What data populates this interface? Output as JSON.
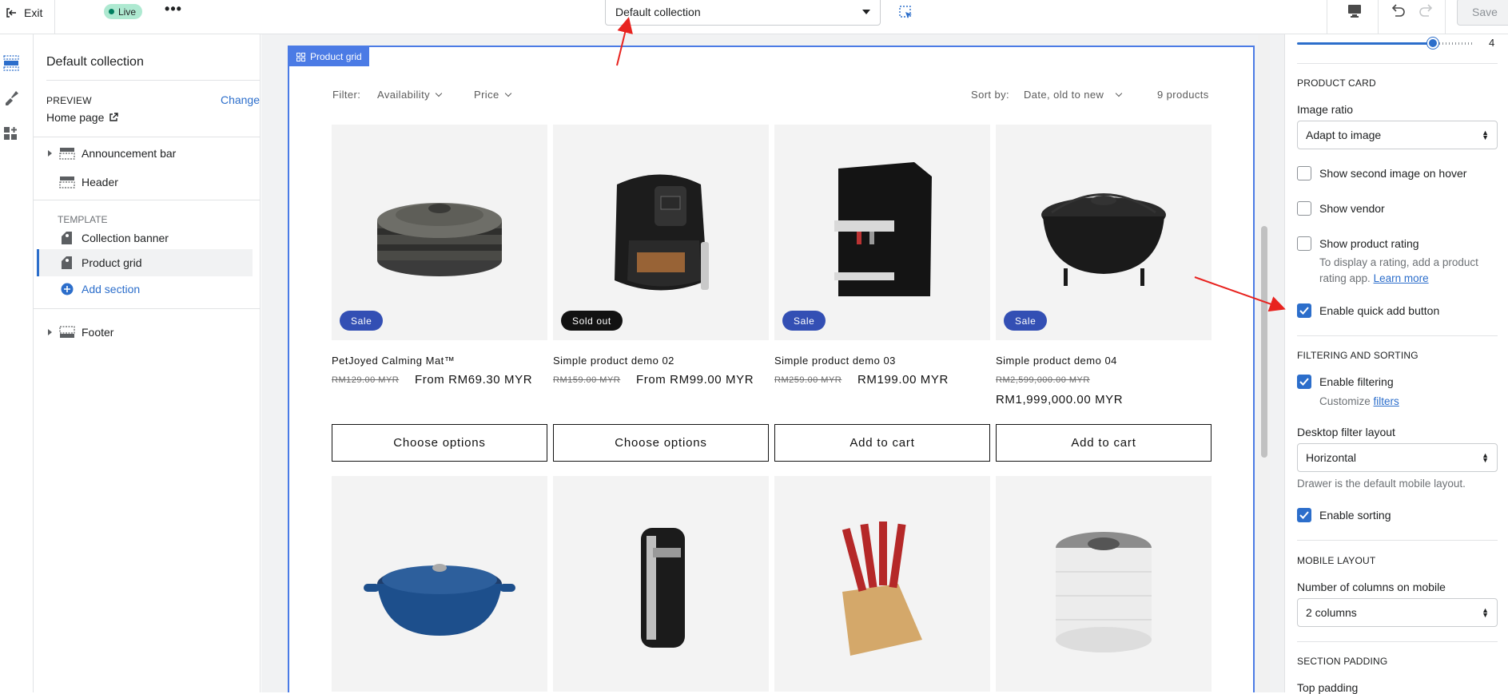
{
  "topbar": {
    "exit_label": "Exit",
    "live_label": "Live",
    "template_select_value": "Default collection",
    "save_label": "Save"
  },
  "sidebar": {
    "title": "Default collection",
    "preview_label": "PREVIEW",
    "change_label": "Change",
    "preview_page": "Home page",
    "items": [
      {
        "label": "Announcement bar"
      },
      {
        "label": "Header"
      }
    ],
    "template_label": "TEMPLATE",
    "template_items": [
      {
        "label": "Collection banner"
      },
      {
        "label": "Product grid"
      }
    ],
    "add_section_label": "Add section",
    "footer_label": "Footer"
  },
  "canvas": {
    "section_tag": "Product grid",
    "filter_label": "Filter:",
    "filter_availability": "Availability",
    "filter_price": "Price",
    "sort_label": "Sort by:",
    "sort_value": "Date, old to new",
    "product_count": "9 products",
    "products": [
      {
        "title": "PetJoyed Calming Mat™",
        "old_price": "RM129.00 MYR",
        "price": "From RM69.30 MYR",
        "badge": "Sale",
        "button": "Choose options"
      },
      {
        "title": "Simple product demo 02",
        "old_price": "RM159.00 MYR",
        "price": "From RM99.00 MYR",
        "badge": "Sold out",
        "button": "Choose options"
      },
      {
        "title": "Simple product demo 03",
        "old_price": "RM259.00 MYR",
        "price": "RM199.00 MYR",
        "badge": "Sale",
        "button": "Add to cart"
      },
      {
        "title": "Simple product demo 04",
        "old_price": "RM2,599,000.00 MYR",
        "price": "RM1,999,000.00 MYR",
        "badge": "Sale",
        "button": "Add to cart"
      }
    ]
  },
  "settings": {
    "range_value": "4",
    "product_card_head": "PRODUCT CARD",
    "image_ratio_label": "Image ratio",
    "image_ratio_value": "Adapt to image",
    "show_second_image": "Show second image on hover",
    "show_vendor": "Show vendor",
    "show_rating": "Show product rating",
    "rating_help_1": "To display a rating, add a product",
    "rating_help_2": "rating app.",
    "learn_more": "Learn more",
    "quick_add": "Enable quick add button",
    "filtering_head": "FILTERING AND SORTING",
    "enable_filtering": "Enable filtering",
    "customize_label": "Customize",
    "filters_link": "filters",
    "desktop_filter_label": "Desktop filter layout",
    "desktop_filter_value": "Horizontal",
    "drawer_help": "Drawer is the default mobile layout.",
    "enable_sorting": "Enable sorting",
    "mobile_head": "MOBILE LAYOUT",
    "mobile_columns_label": "Number of columns on mobile",
    "mobile_columns_value": "2 columns",
    "padding_head": "SECTION PADDING",
    "top_padding_label": "Top padding"
  },
  "colors": {
    "accent": "#2c6ecb",
    "section_highlight": "#4b7be5",
    "sale_badge": "#334fb4",
    "soldout_badge": "#121212",
    "live_badge": "#aee9d1",
    "annotation": "#e8231f"
  },
  "icons": [
    "exit-icon",
    "more-icon",
    "inspect-icon",
    "desktop-icon",
    "undo-icon",
    "redo-icon",
    "sections-icon",
    "theme-settings-icon",
    "apps-icon",
    "external-link-icon",
    "plus-circle-icon"
  ]
}
